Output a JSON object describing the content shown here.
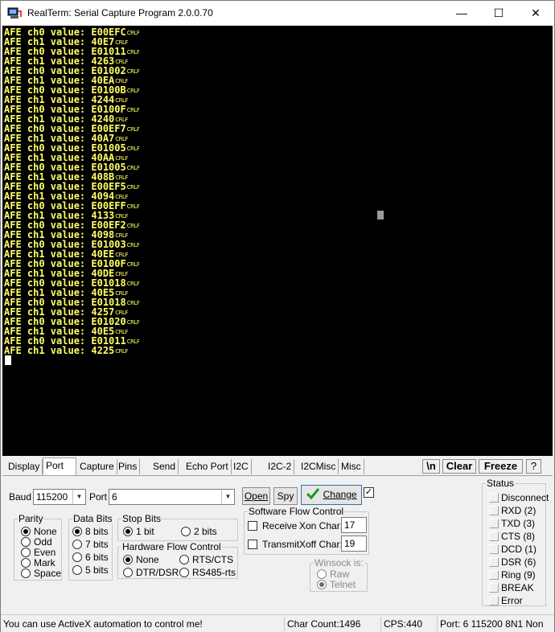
{
  "title": "RealTerm: Serial Capture Program 2.0.0.70",
  "window_controls": {
    "minimize": "—",
    "maximize": "☐",
    "close": "✕"
  },
  "terminal": {
    "crlf": "CRLF",
    "lines": [
      "AFE ch0 value: E00EFC",
      "AFE ch1 value: 40E7",
      "AFE ch0 value: E01011",
      "AFE ch1 value: 4263",
      "AFE ch0 value: E01002",
      "AFE ch1 value: 40EA",
      "AFE ch0 value: E0100B",
      "AFE ch1 value: 4244",
      "AFE ch0 value: E0100F",
      "AFE ch1 value: 4240",
      "AFE ch0 value: E00EF7",
      "AFE ch1 value: 40A7",
      "AFE ch0 value: E01005",
      "AFE ch1 value: 40AA",
      "AFE ch0 value: E01005",
      "AFE ch1 value: 408B",
      "AFE ch0 value: E00EF5",
      "AFE ch1 value: 4094",
      "AFE ch0 value: E00EFF",
      "AFE ch1 value: 4133",
      "AFE ch0 value: E00EF2",
      "AFE ch1 value: 4098",
      "AFE ch0 value: E01003",
      "AFE ch1 value: 40EE",
      "AFE ch0 value: E0100F",
      "AFE ch1 value: 40DE",
      "AFE ch0 value: E01018",
      "AFE ch1 value: 40E5",
      "AFE ch0 value: E01018",
      "AFE ch1 value: 4257",
      "AFE ch0 value: E01020",
      "AFE ch1 value: 40E5",
      "AFE ch0 value: E01011",
      "AFE ch1 value: 4225"
    ]
  },
  "tabs": [
    "Display",
    "Port",
    "Capture",
    "Pins",
    "Send",
    "Echo Port",
    "I2C",
    "I2C-2",
    "I2CMisc",
    "Misc"
  ],
  "active_tab": "Port",
  "toolbar": {
    "newline": "\\n",
    "clear": "Clear",
    "freeze": "Freeze",
    "help": "?"
  },
  "port": {
    "baud_label": "Baud",
    "baud_value": "115200",
    "port_label": "Port",
    "port_value": "6",
    "open_label": "Open",
    "spy_label": "Spy",
    "change_label": "Change",
    "change_checked": true
  },
  "parity": {
    "title": "Parity",
    "options": [
      "None",
      "Odd",
      "Even",
      "Mark",
      "Space"
    ],
    "selected": "None"
  },
  "data_bits": {
    "title": "Data Bits",
    "options": [
      "8 bits",
      "7 bits",
      "6 bits",
      "5 bits"
    ],
    "selected": "8 bits"
  },
  "stop_bits": {
    "title": "Stop Bits",
    "options": [
      "1 bit",
      "2 bits"
    ],
    "selected": "1 bit"
  },
  "hw_flow": {
    "title": "Hardware Flow Control",
    "options": [
      "None",
      "RTS/CTS",
      "DTR/DSR",
      "RS485-rts"
    ],
    "selected": "None"
  },
  "sw_flow": {
    "title": "Software Flow Control",
    "receive_label": "Receive",
    "transmit_label": "Transmit",
    "xon_label": "Xon Char:",
    "xon_value": "17",
    "xoff_label": "Xoff Char:",
    "xoff_value": "19"
  },
  "winsock": {
    "title": "Winsock is:",
    "options": [
      "Raw",
      "Telnet"
    ],
    "selected": "Telnet"
  },
  "status": {
    "title": "Status",
    "items": [
      "Disconnect",
      "RXD (2)",
      "TXD (3)",
      "CTS (8)",
      "DCD (1)",
      "DSR (6)",
      "Ring (9)",
      "BREAK",
      "Error"
    ]
  },
  "statusbar": {
    "message": "You can use ActiveX automation to control me!",
    "char_count": "Char Count:1496",
    "cps": "CPS:440",
    "port_info": "Port: 6 115200 8N1 Non"
  }
}
